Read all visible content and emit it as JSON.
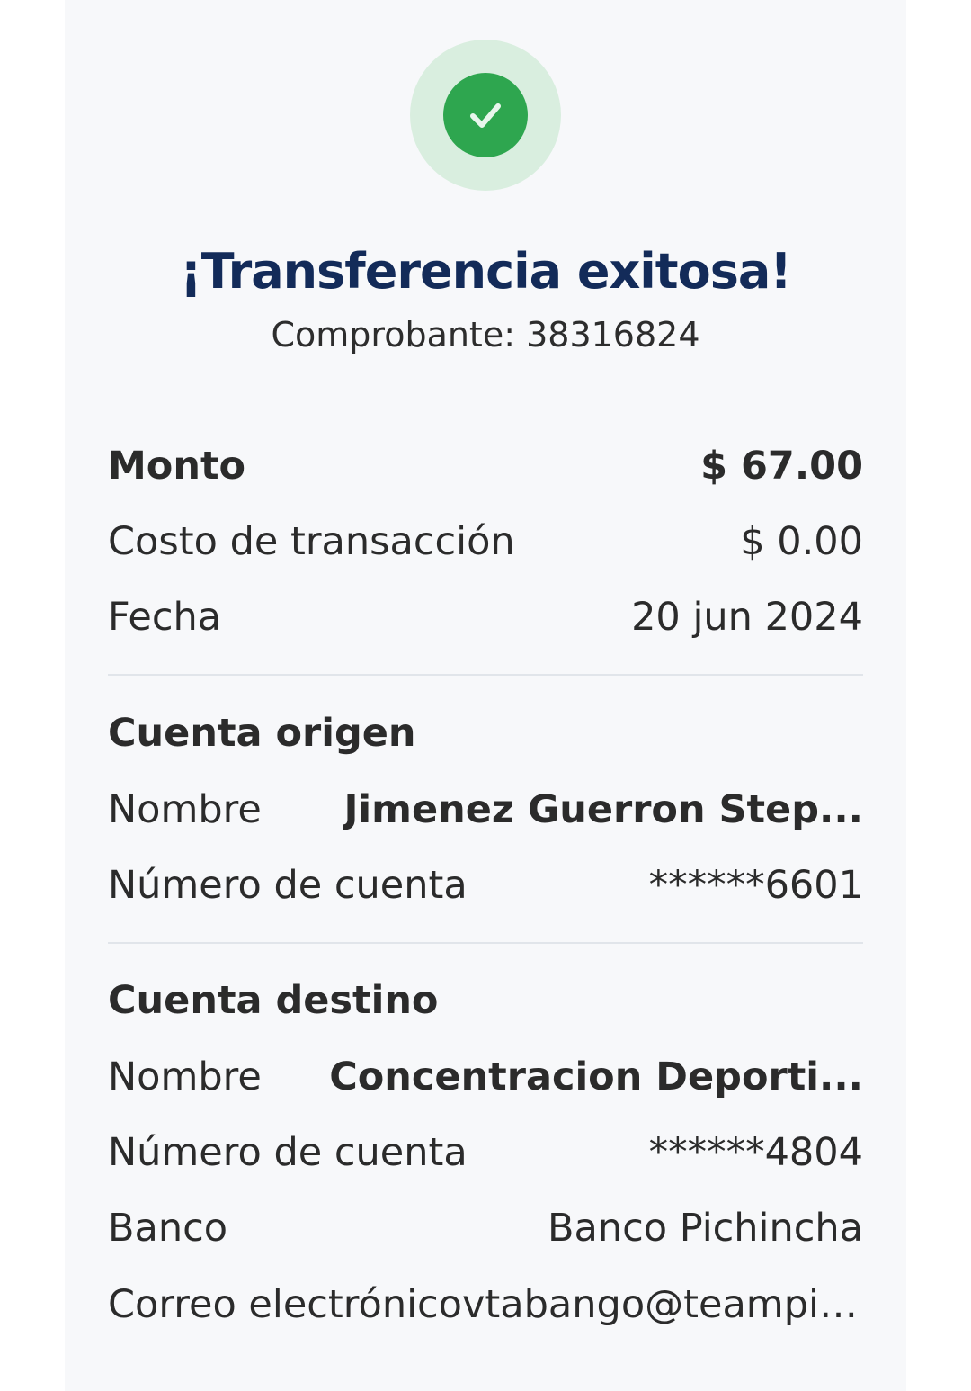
{
  "status": {
    "icon": "check-icon",
    "title": "¡Transferencia exitosa!",
    "receipt_label": "Comprobante: 38316824"
  },
  "summary": {
    "amount_label": "Monto",
    "amount_value": "$ 67.00",
    "fee_label": "Costo de transacción",
    "fee_value": "$ 0.00",
    "date_label": "Fecha",
    "date_value": "20 jun 2024"
  },
  "origin": {
    "section_title": "Cuenta origen",
    "name_label": "Nombre",
    "name_value": "Jimenez  Guerron Step...",
    "account_label": "Número de cuenta",
    "account_value": "******6601"
  },
  "destination": {
    "section_title": "Cuenta destino",
    "name_label": "Nombre",
    "name_value": "Concentracion Deporti...",
    "account_label": "Número de cuenta",
    "account_value": "******4804",
    "bank_label": "Banco",
    "bank_value": "Banco Pichincha",
    "email_label": "Correo electrónico",
    "email_value": "vtabango@teampichi..."
  },
  "colors": {
    "title": "#132b59",
    "success": "#2ea64f",
    "success_halo": "#d9eedf",
    "card_bg": "#f7f8fa"
  }
}
